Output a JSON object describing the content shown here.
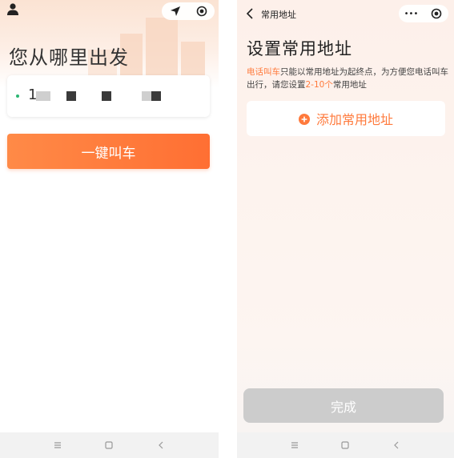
{
  "left": {
    "hero_title": "您从哪里出发",
    "address_prefix": "1",
    "call_button": "一键叫车",
    "icons": {
      "avatar": "avatar-icon",
      "location": "location-arrow-icon",
      "target": "target-icon"
    }
  },
  "right": {
    "page_name": "常用地址",
    "settings_title": "设置常用地址",
    "desc": {
      "highlight1": "电话叫车",
      "part1": "只能以常用地址为起终点，为方便您电话叫车出行，请您设置",
      "highlight2": "2-10个",
      "part2": "常用地址"
    },
    "add_label": "添加常用地址",
    "done_button": "完成",
    "menu_dots": "•••"
  },
  "colors": {
    "accent": "#ff7a3c",
    "button_gradient_start": "#ff8a47",
    "button_gradient_end": "#ff6f33",
    "disabled": "#cccccc",
    "dot_green": "#2bb673"
  }
}
